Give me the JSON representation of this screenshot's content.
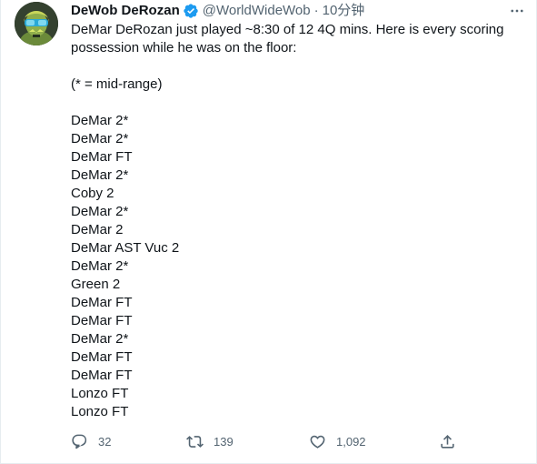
{
  "author": {
    "display_name": "DeWob DeRozan",
    "handle": "@WorldWideWob",
    "time": "10分钟"
  },
  "tweet": {
    "intro_line_1": "DeMar DeRozan just played ~8:30 of 12 4Q mins. Here is every scoring",
    "intro_line_2": "possession while he was on the floor:",
    "legend": "(* = mid-range)",
    "possessions": [
      "DeMar 2*",
      "DeMar 2*",
      "DeMar FT",
      "DeMar 2*",
      "Coby 2",
      "DeMar 2*",
      "DeMar 2",
      "DeMar AST Vuc 2",
      "DeMar 2*",
      "Green 2",
      "DeMar FT",
      "DeMar FT",
      "DeMar 2*",
      "DeMar FT",
      "DeMar FT",
      "Lonzo FT",
      "Lonzo FT"
    ]
  },
  "actions": {
    "replies": "32",
    "retweets": "139",
    "likes": "1,092"
  },
  "colors": {
    "text": "#0f1419",
    "secondary": "#536471",
    "verified": "#1d9bf0",
    "border": "#e6ecf0"
  }
}
